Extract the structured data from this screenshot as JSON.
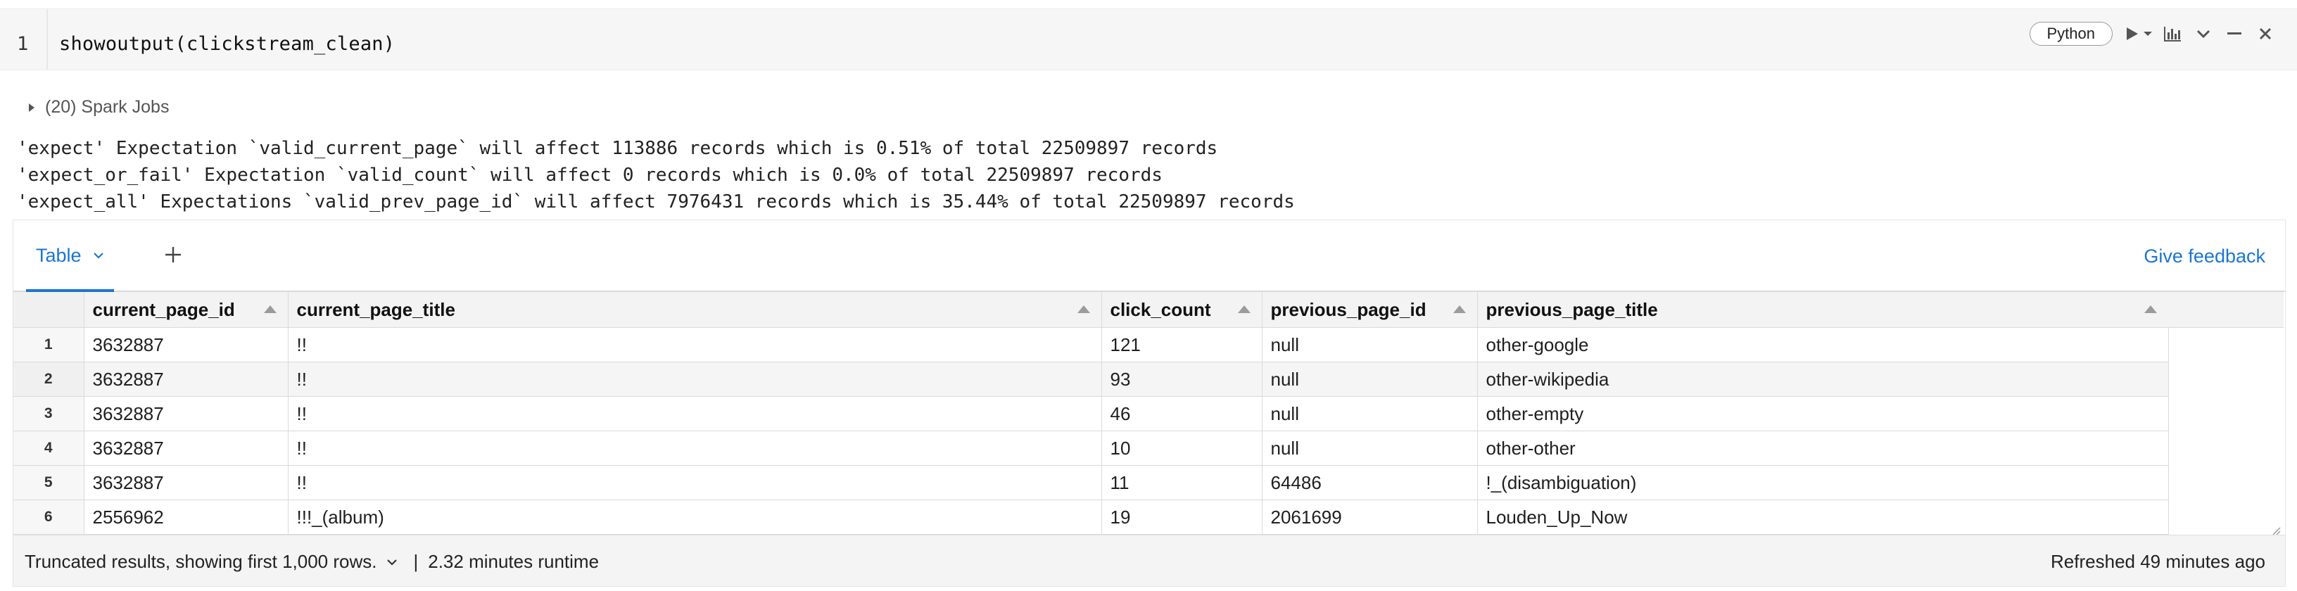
{
  "cell": {
    "line_number": "1",
    "code": "showoutput(clickstream_clean)",
    "language": "Python",
    "toolbar_icons": [
      "run-icon",
      "run-dropdown-icon",
      "chart-icon",
      "collapse-icon",
      "minimize-icon",
      "close-icon"
    ]
  },
  "output": {
    "spark_jobs": "(20) Spark Jobs",
    "lines": [
      "'expect' Expectation `valid_current_page` will affect 113886 records which is 0.51% of total 22509897 records",
      "'expect_or_fail' Expectation `valid_count` will affect 0 records which is 0.0% of total 22509897 records",
      "'expect_all' Expectations `valid_prev_page_id` will affect 7976431 records which is 35.44% of total 22509897 records"
    ]
  },
  "result": {
    "tab_label": "Table",
    "add_tab": "+",
    "feedback": "Give feedback",
    "columns": [
      "current_page_id",
      "current_page_title",
      "click_count",
      "previous_page_id",
      "previous_page_title"
    ],
    "rows": [
      [
        "1",
        "3632887",
        "!!",
        "121",
        "null",
        "other-google"
      ],
      [
        "2",
        "3632887",
        "!!",
        "93",
        "null",
        "other-wikipedia"
      ],
      [
        "3",
        "3632887",
        "!!",
        "46",
        "null",
        "other-empty"
      ],
      [
        "4",
        "3632887",
        "!!",
        "10",
        "null",
        "other-other"
      ],
      [
        "5",
        "3632887",
        "!!",
        "11",
        "64486",
        "!_(disambiguation)"
      ],
      [
        "6",
        "2556962",
        "!!!_(album)",
        "19",
        "2061699",
        "Louden_Up_Now"
      ]
    ],
    "footer": {
      "truncated": "Truncated results, showing first 1,000 rows.",
      "separator": "|",
      "runtime": "2.32 minutes runtime",
      "refreshed": "Refreshed 49 minutes ago"
    }
  },
  "colors": {
    "accent": "#1b76d1",
    "header_bg": "#f3f3f3",
    "editor_bg": "#f6f6f6"
  }
}
